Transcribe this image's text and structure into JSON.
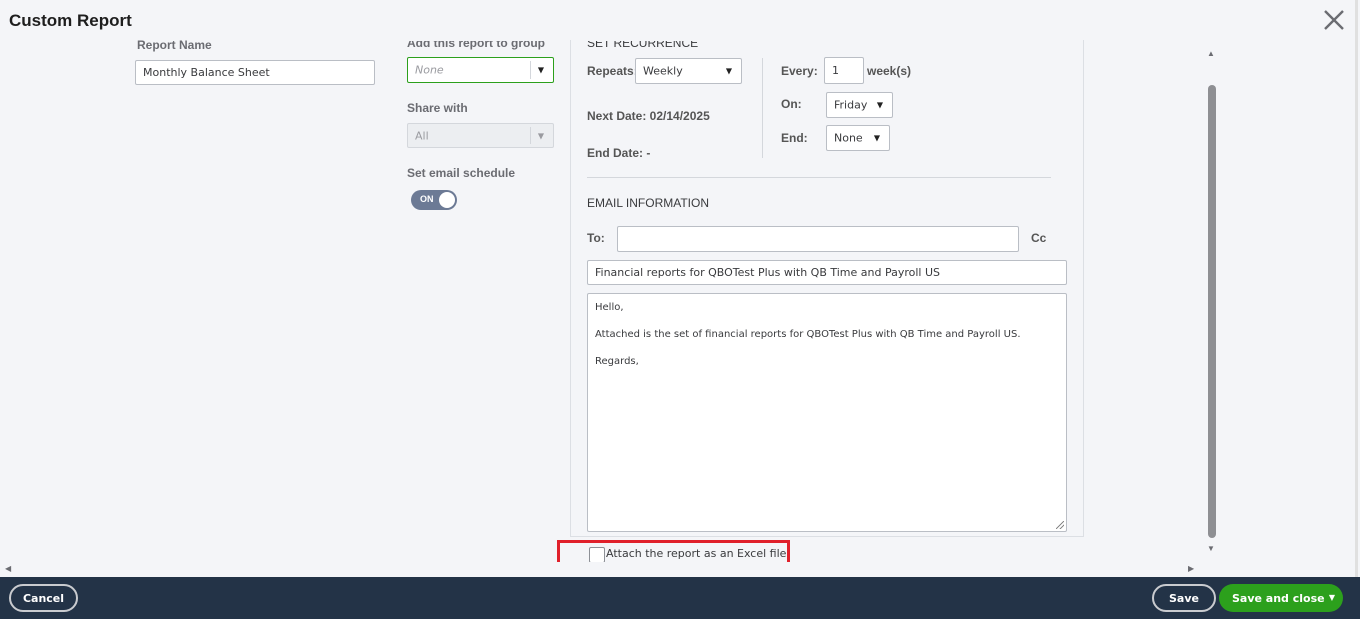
{
  "window": {
    "title": "Custom Report"
  },
  "report_name": {
    "label": "Report Name",
    "value": "Monthly Balance Sheet"
  },
  "group": {
    "label": "Add this report to group",
    "placeholder": "None"
  },
  "share": {
    "label": "Share with",
    "value": "All"
  },
  "email_schedule": {
    "label": "Set email schedule",
    "toggle": "ON"
  },
  "recurrence": {
    "heading": "SET RECURRENCE",
    "repeats_label": "Repeats:",
    "repeats_value": "Weekly",
    "next_date": "Next Date: 02/14/2025",
    "end_date": "End Date: -",
    "every_label": "Every:",
    "every_value": "1",
    "every_unit": "week(s)",
    "on_label": "On:",
    "on_value": "Friday",
    "end_label": "End:",
    "end_value": "None"
  },
  "email": {
    "heading": "EMAIL INFORMATION",
    "to_label": "To:",
    "to_value": "",
    "cc_label": "Cc",
    "subject": "Financial reports for QBOTest Plus with QB Time and Payroll US",
    "body_lines": [
      "Hello,",
      "Attached is the set of financial reports for QBOTest Plus with QB Time and Payroll US.",
      "Regards,"
    ]
  },
  "attach": {
    "label": "Attach the report as an Excel file",
    "checked": false
  },
  "footer": {
    "cancel": "Cancel",
    "save": "Save",
    "save_close": "Save and close"
  },
  "icons": {
    "close": "close-icon",
    "dropdown": "chevron-down-icon"
  },
  "colors": {
    "accent": "#2ca01c",
    "footer_bg": "#233347",
    "highlight": "#e0202b"
  }
}
